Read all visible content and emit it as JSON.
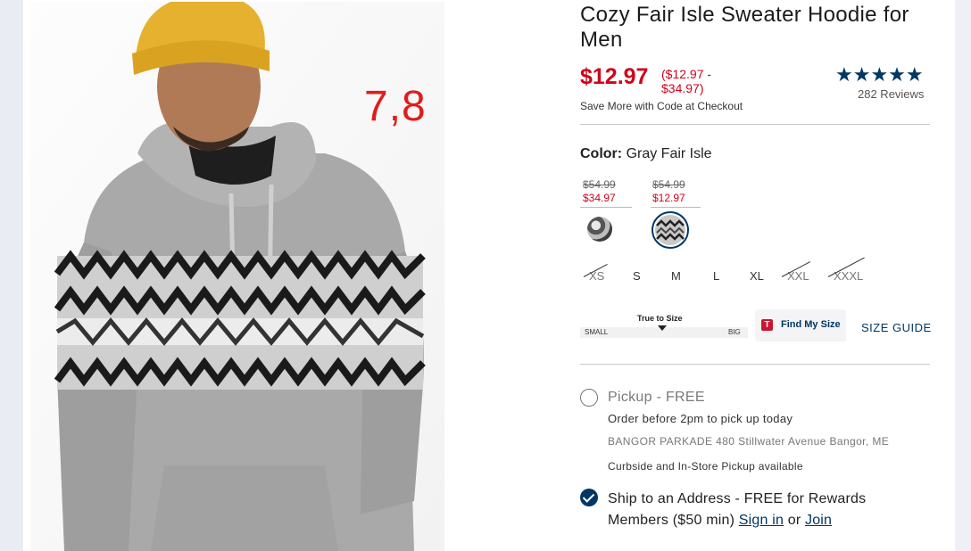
{
  "overlay_label": "7,8",
  "product": {
    "title": "Cozy Fair Isle Sweater Hoodie for Men",
    "price": "$12.97",
    "price_range": "($12.97 - $34.97)",
    "save_more": "Save More with Code at Checkout",
    "rating": {
      "stars": "★★★★★",
      "value": 5,
      "reviews": "282 Reviews"
    }
  },
  "color": {
    "label": "Color:",
    "value": "Gray Fair Isle",
    "swatches": [
      {
        "was": "$54.99",
        "now": "$34.97",
        "selected": false
      },
      {
        "was": "$54.99",
        "now": "$12.97",
        "selected": true
      }
    ]
  },
  "sizes": [
    {
      "label": "XS",
      "available": false
    },
    {
      "label": "S",
      "available": true
    },
    {
      "label": "M",
      "available": true
    },
    {
      "label": "L",
      "available": true
    },
    {
      "label": "XL",
      "available": true
    },
    {
      "label": "XXL",
      "available": false
    },
    {
      "label": "XXXL",
      "available": false
    }
  ],
  "fit": {
    "title": "True to Size",
    "small": "SMALL",
    "big": "BIG"
  },
  "find_my_size": {
    "icon": "T",
    "label": "Find My Size"
  },
  "size_guide": "SIZE GUIDE",
  "fulfillment": {
    "pickup": {
      "title": "Pickup - FREE",
      "order_before": "Order before 2pm to pick up today",
      "store": "BANGOR PARKADE 480 Stillwater Avenue  Bangor, ME",
      "curbside": "Curbside and In-Store Pickup available",
      "selected": false
    },
    "ship": {
      "text_before": "Ship to an Address - FREE for Rewards Members ($50 min) ",
      "sign_in": "Sign in",
      "or": " or ",
      "join": "Join",
      "selected": true
    }
  },
  "colors": {
    "brand_navy": "#003764",
    "sale_red": "#d0021b"
  }
}
